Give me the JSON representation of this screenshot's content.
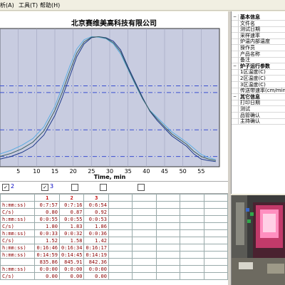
{
  "menu": {
    "items": [
      "析(A)",
      "工具(T)",
      "帮助(H)"
    ]
  },
  "chart": {
    "title": "北京赛维美高科技有限公司"
  },
  "chart_data": {
    "type": "line",
    "title": "北京赛维美高科技有限公司",
    "xlabel": "Time, min",
    "ylabel": "",
    "xlim": [
      0,
      60
    ],
    "ylim": [
      0,
      270
    ],
    "x_ticks": [
      0,
      5,
      10,
      15,
      20,
      25,
      30,
      35,
      40,
      45,
      50,
      55
    ],
    "reference_lines_y": [
      20,
      72,
      145,
      158
    ],
    "grid": true,
    "series": [
      {
        "name": "1",
        "color": "#1e3a8a",
        "x": [
          0,
          3,
          6,
          9,
          12,
          15,
          17,
          19,
          21,
          23,
          25,
          27,
          29,
          31,
          33,
          35,
          37,
          39,
          41,
          43,
          45,
          47,
          49,
          51,
          53,
          55,
          57,
          59
        ],
        "y": [
          15,
          20,
          28,
          40,
          62,
          100,
          135,
          175,
          215,
          240,
          252,
          254,
          252,
          245,
          228,
          195,
          165,
          135,
          108,
          90,
          75,
          60,
          50,
          40,
          25,
          15,
          12,
          10
        ]
      },
      {
        "name": "2",
        "color": "#5dade2",
        "x": [
          0,
          3,
          6,
          9,
          12,
          15,
          17,
          19,
          21,
          23,
          25,
          27,
          29,
          31,
          33,
          35,
          37,
          39,
          41,
          43,
          45,
          47,
          49,
          51,
          53,
          55,
          57,
          59
        ],
        "y": [
          25,
          32,
          42,
          55,
          78,
          118,
          155,
          195,
          230,
          248,
          254,
          253,
          250,
          240,
          220,
          190,
          160,
          132,
          110,
          96,
          82,
          68,
          58,
          48,
          36,
          24,
          18,
          14
        ]
      },
      {
        "name": "3",
        "color": "#3a5f5f",
        "x": [
          0,
          3,
          6,
          9,
          12,
          15,
          17,
          19,
          21,
          23,
          25,
          27,
          29,
          31,
          33,
          35,
          37,
          39,
          41,
          43,
          45,
          47,
          49,
          51,
          53,
          55,
          57,
          59
        ],
        "y": [
          20,
          26,
          35,
          48,
          70,
          110,
          145,
          185,
          222,
          244,
          253,
          254,
          251,
          242,
          224,
          192,
          162,
          133,
          109,
          93,
          78,
          64,
          54,
          44,
          30,
          20,
          15,
          12
        ]
      }
    ]
  },
  "checkboxes": [
    {
      "checked": true,
      "label": "2"
    },
    {
      "checked": true,
      "label": "3"
    },
    {
      "checked": false,
      "label": ""
    },
    {
      "checked": false,
      "label": ""
    },
    {
      "checked": false,
      "label": ""
    }
  ],
  "table": {
    "headers": [
      "",
      "1",
      "2",
      "3",
      "",
      "",
      "",
      "",
      ""
    ],
    "rows": [
      [
        "h:mm:ss)",
        "0:7:57",
        "0:7:16",
        "0:6:54"
      ],
      [
        "C/s)",
        "0.80",
        "0.87",
        "0.92"
      ],
      [
        "h:mm:ss)",
        "0:0:55",
        "0:0:55",
        "0:0:53"
      ],
      [
        "C/s)",
        "1.80",
        "1.83",
        "1.86"
      ],
      [
        "h:mm:ss)",
        "0:0:33",
        "0:0:32",
        "0:0:36"
      ],
      [
        "C/s)",
        "1.52",
        "1.58",
        "1.42"
      ],
      [
        "h:mm:ss)",
        "0:16:46",
        "0:16:34",
        "0:16:17"
      ],
      [
        "h:mm:ss)",
        "0:14:59",
        "0:14:45",
        "0:14:19"
      ],
      [
        "",
        "835.86",
        "845.91",
        "842.36"
      ],
      [
        "h:mm:ss)",
        "0:0:00",
        "0:0:00",
        "0:0:00"
      ],
      [
        "C/s)",
        "0.00",
        "0.00",
        "0.00"
      ]
    ]
  },
  "info_panel": {
    "rows": [
      {
        "label": "基本信息",
        "section": true,
        "marker": "−"
      },
      {
        "label": "文件名"
      },
      {
        "label": "测试日期"
      },
      {
        "label": "采样速率"
      },
      {
        "label": "炉温内部温度"
      },
      {
        "label": "操作员"
      },
      {
        "label": "产品名称"
      },
      {
        "label": "备注"
      },
      {
        "label": "炉子运行参数",
        "section": true,
        "marker": "−"
      },
      {
        "label": "1区温度(C)"
      },
      {
        "label": "2区温度(C)"
      },
      {
        "label": "3区温度(C)"
      },
      {
        "label": "传送带速率(cm/min)"
      },
      {
        "label": "其它信息",
        "section": true,
        "marker": "−"
      },
      {
        "label": "打印日期"
      },
      {
        "label": "测试"
      },
      {
        "label": "品管确认"
      },
      {
        "label": "主持确认"
      }
    ]
  },
  "colors": {
    "plot_background": "#c8cce0",
    "reference_line": "#3a4fd0",
    "table_text": "#8b0000"
  }
}
